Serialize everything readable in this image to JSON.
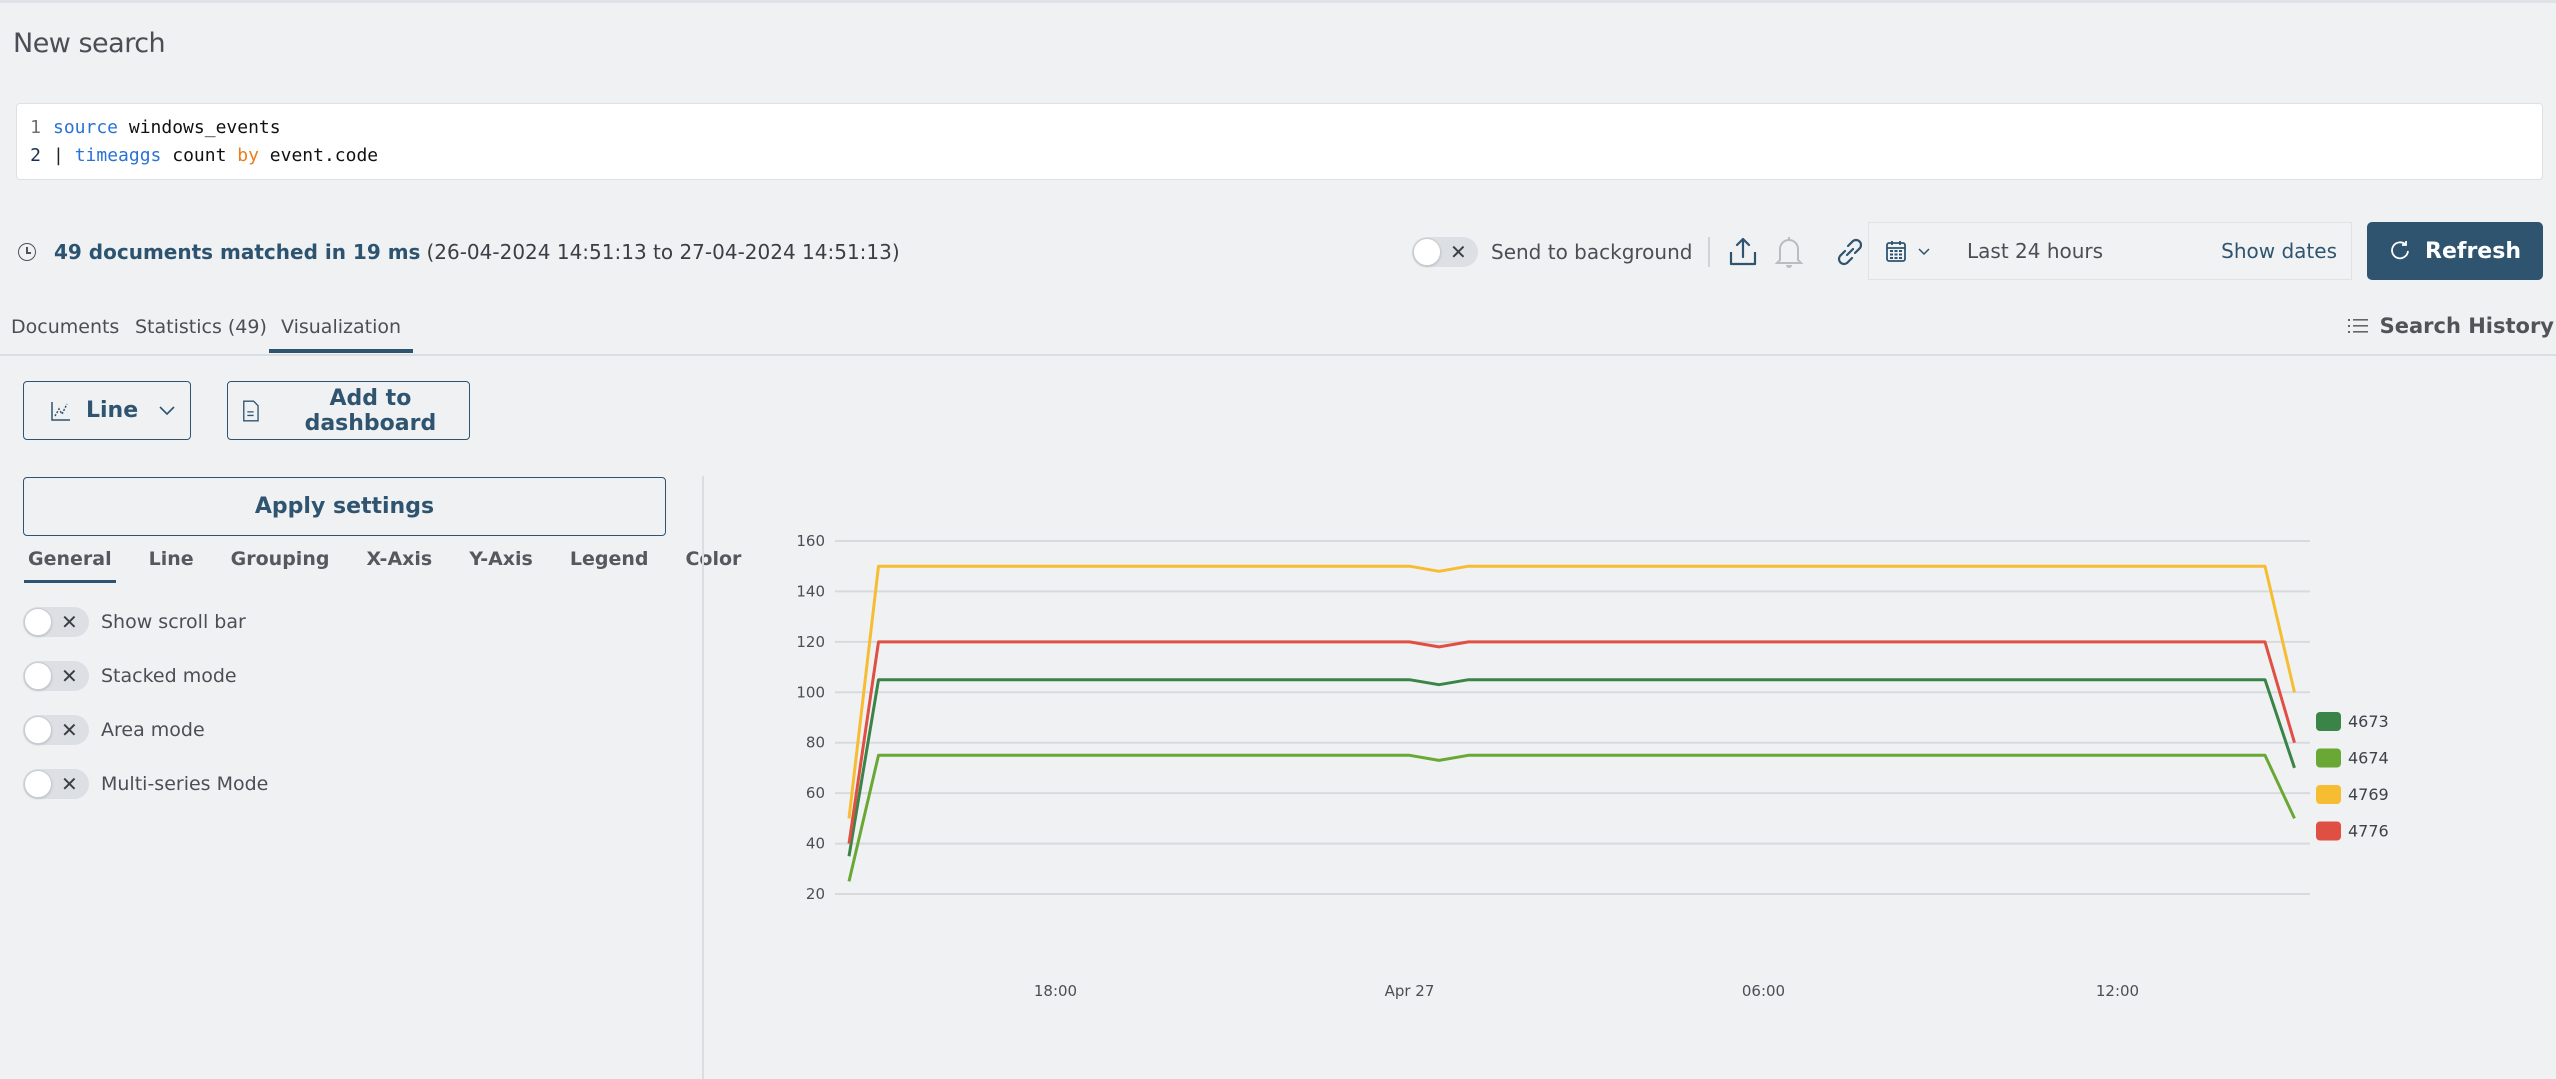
{
  "page": {
    "title": "New search"
  },
  "query": {
    "lines": [
      {
        "number": "1",
        "tokens": [
          {
            "text": "source",
            "style": "kw-blue"
          },
          {
            "text": " windows_events",
            "style": "code-text"
          }
        ]
      },
      {
        "number": "2",
        "tokens": [
          {
            "text": "| ",
            "style": "pipe"
          },
          {
            "text": "timeaggs",
            "style": "kw-blue"
          },
          {
            "text": " count ",
            "style": "code-text"
          },
          {
            "text": "by",
            "style": "kw-orange"
          },
          {
            "text": " event.code",
            "style": "code-text"
          }
        ]
      }
    ]
  },
  "status": {
    "icon": "clock-icon",
    "summary": "49 documents matched in 19 ms",
    "range": "(26-04-2024 14:51:13 to 27-04-2024 14:51:13)"
  },
  "toolbar": {
    "send_to_background_label": "Send to background",
    "send_to_background_on": false,
    "date_range": "Last 24 hours",
    "show_dates_label": "Show dates",
    "refresh_label": "Refresh"
  },
  "tabs": [
    {
      "label": "Documents",
      "active": false
    },
    {
      "label": "Statistics (49)",
      "active": false
    },
    {
      "label": "Visualization",
      "active": true
    }
  ],
  "search_history_label": "Search History",
  "visualization": {
    "chart_type_label": "Line",
    "add_to_dashboard_label": "Add to dashboard",
    "apply_settings_label": "Apply settings",
    "settings_tabs": [
      {
        "label": "General",
        "active": true
      },
      {
        "label": "Line",
        "active": false
      },
      {
        "label": "Grouping",
        "active": false
      },
      {
        "label": "X-Axis",
        "active": false
      },
      {
        "label": "Y-Axis",
        "active": false
      },
      {
        "label": "Legend",
        "active": false
      },
      {
        "label": "Color",
        "active": false
      }
    ],
    "options": [
      {
        "label": "Show scroll bar",
        "enabled": false
      },
      {
        "label": "Stacked mode",
        "enabled": false
      },
      {
        "label": "Area mode",
        "enabled": false
      },
      {
        "label": "Multi-series Mode",
        "enabled": false
      }
    ]
  },
  "chart_data": {
    "type": "line",
    "title": "",
    "xlabel": "",
    "ylabel": "",
    "x_interval": "30 minutes",
    "x_points": 50,
    "x_ticks": [
      {
        "label": "18:00",
        "index": 7
      },
      {
        "label": "Apr 27",
        "index": 19
      },
      {
        "label": "06:00",
        "index": 31
      },
      {
        "label": "12:00",
        "index": 43
      }
    ],
    "ylim": [
      20,
      160
    ],
    "y_ticks": [
      20,
      40,
      60,
      80,
      100,
      120,
      140,
      160
    ],
    "grid": true,
    "legend_position": "right",
    "series": [
      {
        "name": "4673",
        "color": "#3a8447",
        "start": 35,
        "plateau": 105,
        "dip_index": 20,
        "dip_value": 103,
        "end": 70
      },
      {
        "name": "4674",
        "color": "#69a834",
        "start": 25,
        "plateau": 75,
        "dip_index": 20,
        "dip_value": 73,
        "end": 50
      },
      {
        "name": "4769",
        "color": "#f6bd33",
        "start": 50,
        "plateau": 150,
        "dip_index": 20,
        "dip_value": 148,
        "end": 100
      },
      {
        "name": "4776",
        "color": "#e04f44",
        "start": 40,
        "plateau": 120,
        "dip_index": 20,
        "dip_value": 118,
        "end": 80
      }
    ]
  }
}
